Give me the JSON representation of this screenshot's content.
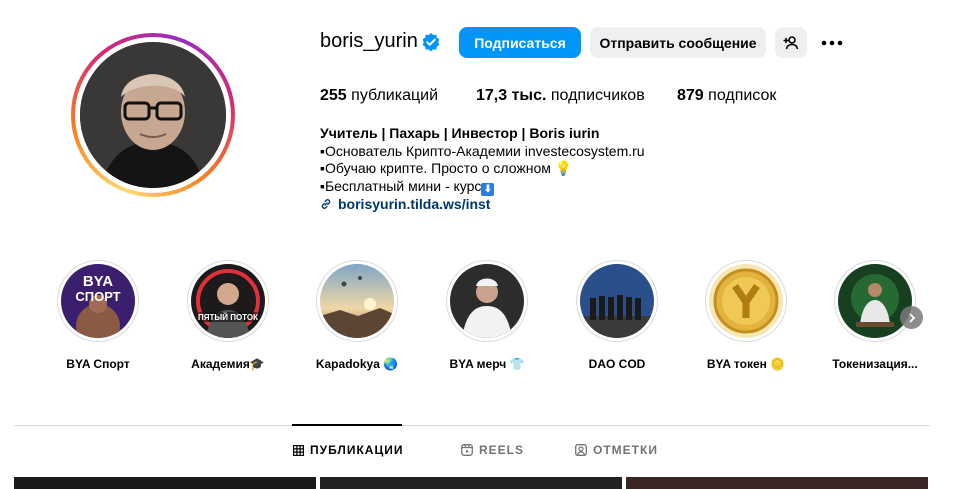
{
  "profile": {
    "username": "boris_yurin",
    "verified": true,
    "follow_label": "Подписаться",
    "message_label": "Отправить сообщение",
    "posts_count": "255",
    "posts_label": " публикаций",
    "followers_count": "17,3 тыс.",
    "followers_label": " подписчиков",
    "following_count": "879",
    "following_label": " подписок",
    "bio_name": "Учитель | Пахарь | Инвестор | Boris iurin",
    "bio_lines": [
      "▪Основатель Крипто-Академии investecosystem.ru",
      "▪Обучаю крипте. Просто о сложном 💡",
      "▪Бесплатный мини - курс"
    ],
    "bio_emoji": "⬇",
    "link": "borisyurin.tilda.ws/inst"
  },
  "highlights": [
    {
      "label": "BYA Спорт",
      "cover_text": "BYA\nСПОРТ"
    },
    {
      "label": "Академия🎓",
      "cover_text": "ПЯТЫЙ ПОТОК"
    },
    {
      "label": "Kapadokya 🌏"
    },
    {
      "label": "BYA мерч 👕"
    },
    {
      "label": "DAO COD"
    },
    {
      "label": "BYA токен 🪙"
    },
    {
      "label": "Токенизация..."
    }
  ],
  "tabs": [
    {
      "label": "ПУБЛИКАЦИИ",
      "active": true
    },
    {
      "label": "REELS",
      "active": false
    },
    {
      "label": "ОТМЕТКИ",
      "active": false
    }
  ],
  "colors": {
    "accent": "#0095f6",
    "link": "#00376b",
    "verified": "#0095f6"
  }
}
